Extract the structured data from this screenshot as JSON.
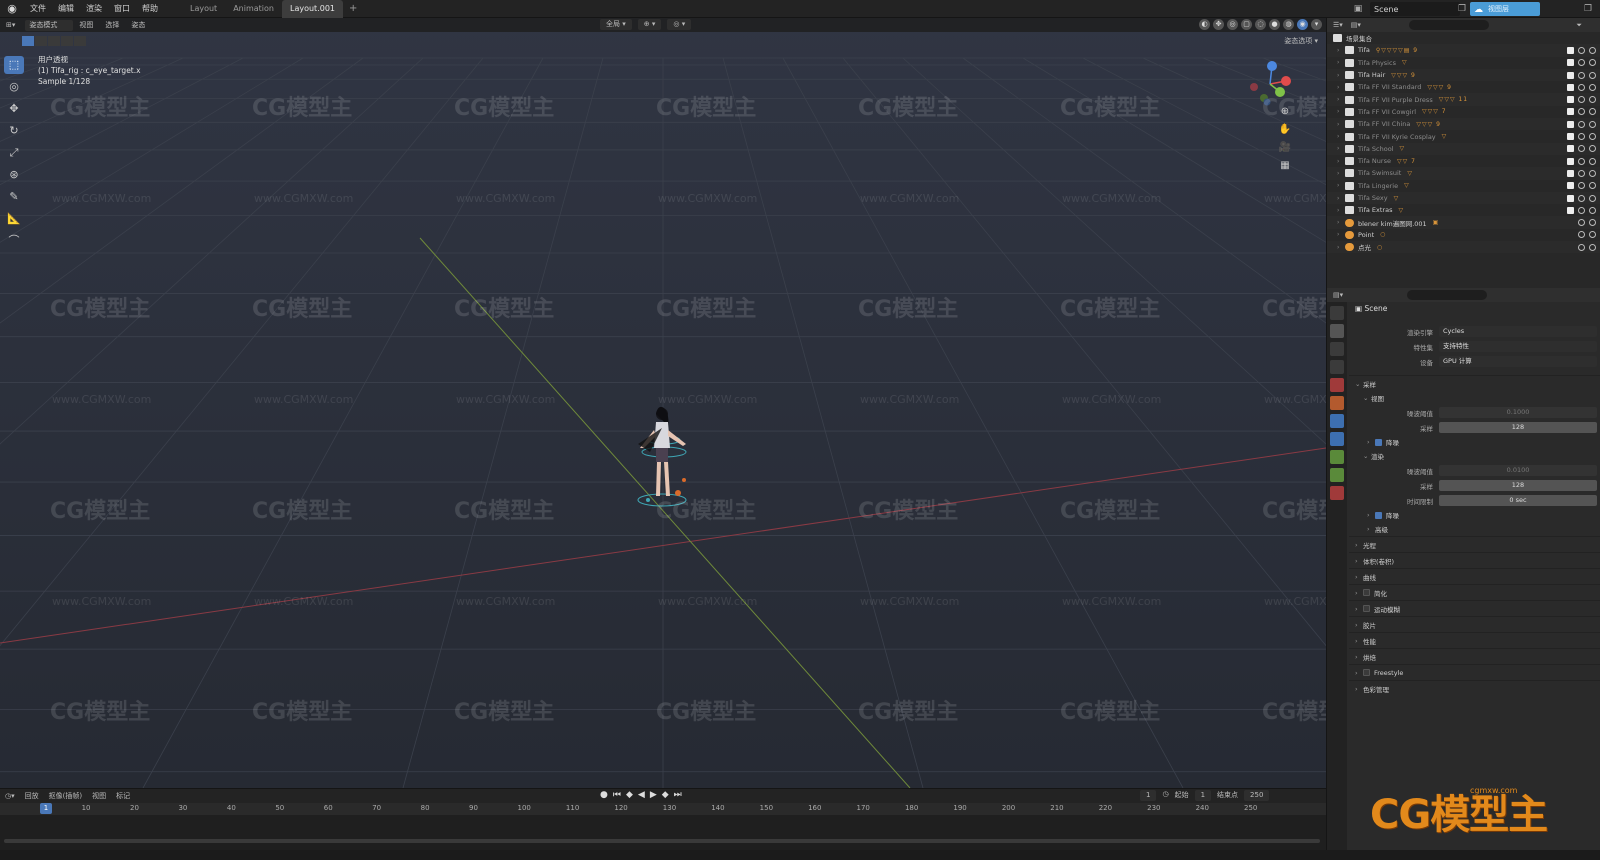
{
  "topbar": {
    "menus": [
      "文件",
      "编辑",
      "渲染",
      "窗口",
      "帮助"
    ],
    "workspace_tabs": [
      "Layout",
      "Animation",
      "Layout.001"
    ],
    "active_tab_index": 2,
    "scene": "Scene",
    "view_layer": "视图层"
  },
  "viewport": {
    "header": {
      "mode": "姿态模式",
      "menus": [
        "视图",
        "选择",
        "姿态"
      ],
      "pivot": "全局",
      "overlay_label": "姿态选项"
    },
    "info": {
      "view_name": "用户透视",
      "active_object": "(1) Tifa_rig : c_eye_target.x",
      "sample": "Sample 1/128"
    },
    "gizmo_axes": {
      "x": "#e04c4c",
      "y": "#7fc248",
      "z": "#4c88e0"
    }
  },
  "watermark": {
    "brand": "CG模型主",
    "url": "www.CGMXW.com"
  },
  "timeline": {
    "menus": [
      "回放",
      "抠像(插帧)",
      "视图",
      "标记"
    ],
    "current_frame": "1",
    "start_label": "起始",
    "start": "1",
    "end_label": "结束点",
    "end": "250",
    "ticks": [
      "10",
      "20",
      "30",
      "40",
      "50",
      "60",
      "70",
      "80",
      "90",
      "100",
      "110",
      "120",
      "130",
      "140",
      "150",
      "160",
      "170",
      "180",
      "190",
      "200",
      "210",
      "220",
      "230",
      "240",
      "250"
    ]
  },
  "outliner": {
    "root": "场景集合",
    "rows": [
      {
        "label": "Tifa",
        "type": "col",
        "dim": false,
        "badges": "⚲▽▽▽▽▤ 9"
      },
      {
        "label": "Tifa Physics",
        "type": "col",
        "dim": true,
        "badges": "▽"
      },
      {
        "label": "Tifa Hair",
        "type": "col",
        "dim": false,
        "badges": "▽▽▽ 9"
      },
      {
        "label": "Tifa FF VII Standard",
        "type": "col",
        "dim": true,
        "badges": "▽▽▽ 9"
      },
      {
        "label": "Tifa FF VII Purple Dress",
        "type": "col",
        "dim": true,
        "badges": "▽▽▽ 11"
      },
      {
        "label": "Tifa FF VII Cowgirl",
        "type": "col",
        "dim": true,
        "badges": "▽▽▽ 7"
      },
      {
        "label": "Tifa FF VII China",
        "type": "col",
        "dim": true,
        "badges": "▽▽▽ 9"
      },
      {
        "label": "Tifa FF VII Kyrie Cosplay",
        "type": "col",
        "dim": true,
        "badges": "▽"
      },
      {
        "label": "Tifa School",
        "type": "col",
        "dim": true,
        "badges": "▽"
      },
      {
        "label": "Tifa Nurse",
        "type": "col",
        "dim": true,
        "badges": "▽▽ 7"
      },
      {
        "label": "Tifa Swimsuit",
        "type": "col",
        "dim": true,
        "badges": "▽"
      },
      {
        "label": "Tifa Lingerie",
        "type": "col",
        "dim": true,
        "badges": "▽"
      },
      {
        "label": "Tifa Sexy",
        "type": "col",
        "dim": true,
        "badges": "▽"
      },
      {
        "label": "Tifa Extras",
        "type": "col",
        "dim": false,
        "badges": "▽"
      },
      {
        "label": "blener kim遍图网.001",
        "type": "obj",
        "dim": false,
        "badges": "▣"
      },
      {
        "label": "Point",
        "type": "obj",
        "dim": false,
        "badges": "○"
      },
      {
        "label": "点光",
        "type": "obj",
        "dim": false,
        "badges": "○"
      }
    ]
  },
  "properties": {
    "scene": "Scene",
    "render_engine_label": "渲染引擎",
    "render_engine": "Cycles",
    "feature_set_label": "特性集",
    "feature_set": "支持特性",
    "device_label": "设备",
    "device": "GPU 计算",
    "sampling": "采样",
    "viewport": "视图",
    "noise_threshold_label": "噪波阈值",
    "viewport_noise": "0.1000",
    "samples_label": "采样",
    "viewport_samples": "128",
    "denoise": "降噪",
    "render": "渲染",
    "render_noise": "0.0100",
    "render_samples": "128",
    "time_limit_label": "时间限制",
    "time_limit": "0 sec",
    "advanced": "高级",
    "sections": [
      "光程",
      "体积(卷积)",
      "曲线",
      "简化",
      "运动模糊",
      "胶片",
      "性能",
      "烘焙",
      "Freestyle",
      "色彩管理"
    ]
  },
  "branding": {
    "logo": "CG模型主",
    "url": "cgmxw.com"
  }
}
